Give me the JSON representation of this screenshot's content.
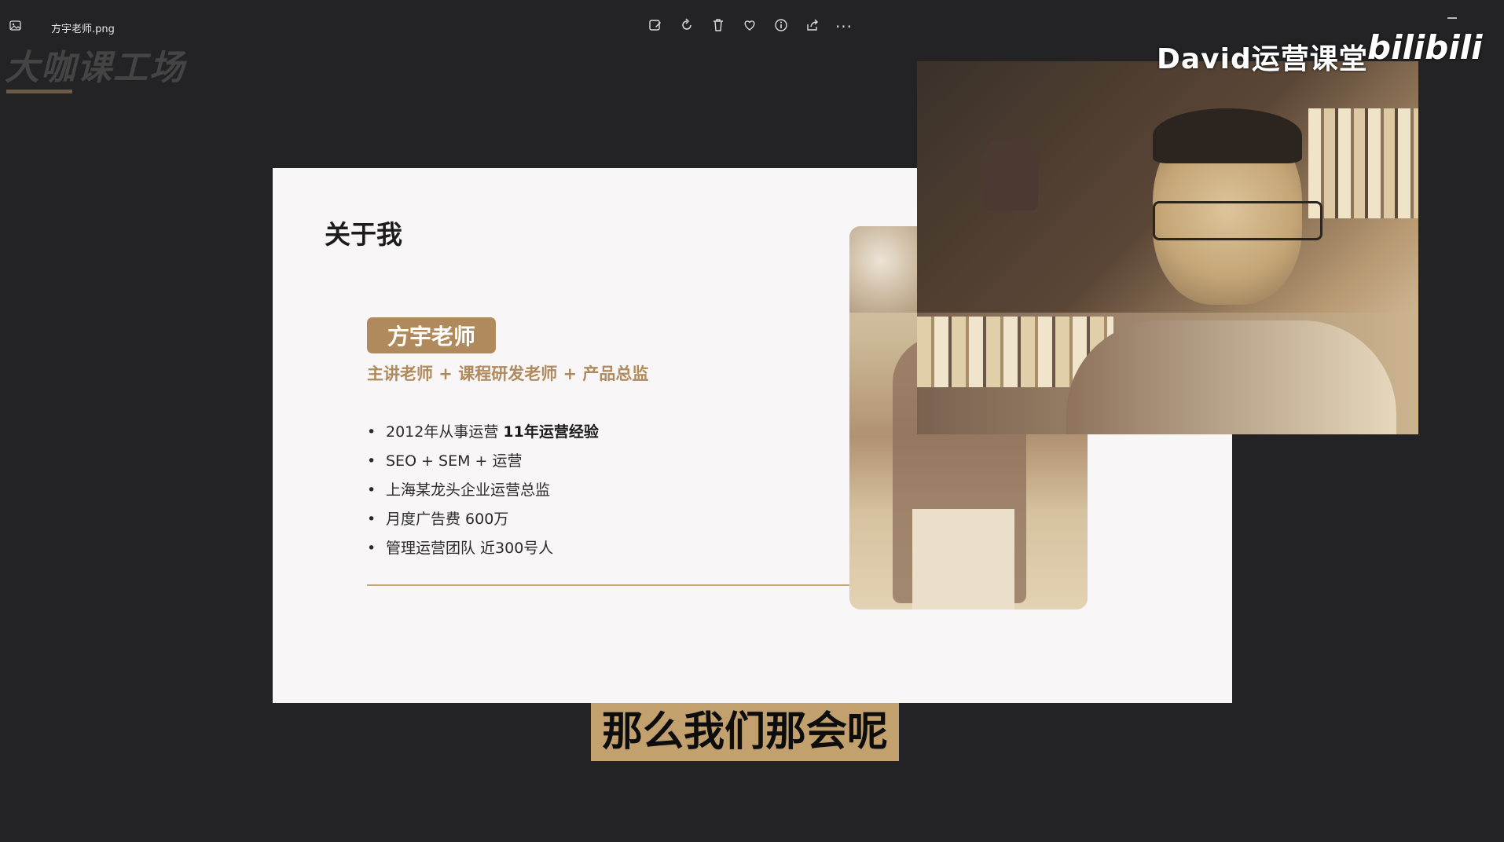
{
  "titlebar": {
    "filename": "方宇老师.png",
    "toolbar": [
      "edit-image-icon",
      "rotate-icon",
      "delete-icon",
      "favorite-icon",
      "info-icon",
      "share-icon",
      "more-icon"
    ],
    "more_label": "···"
  },
  "watermark": {
    "text": "大咖课工场"
  },
  "slide": {
    "title": "关于我",
    "name": "方宇老师",
    "roles": "主讲老师 + 课程研发老师 + 产品总监",
    "bullets": [
      {
        "text": "2012年从事运营 ",
        "bold": "11年运营经验"
      },
      {
        "text": "SEO + SEM + 运营",
        "bold": ""
      },
      {
        "text": "上海某龙头企业运营总监",
        "bold": ""
      },
      {
        "text": "月度广告费 600万",
        "bold": ""
      },
      {
        "text": "管理运营团队 近300号人",
        "bold": ""
      }
    ]
  },
  "video_overlay": {
    "channel_name": "David运营课堂",
    "logo_text": "bilibili"
  },
  "subtitle": {
    "text": "那么我们那会呢"
  },
  "colors": {
    "accent_gold": "#b08a5c",
    "background": "#232224",
    "slide_bg": "#f8f6f6",
    "subtitle_bg": "#c3a16f"
  }
}
